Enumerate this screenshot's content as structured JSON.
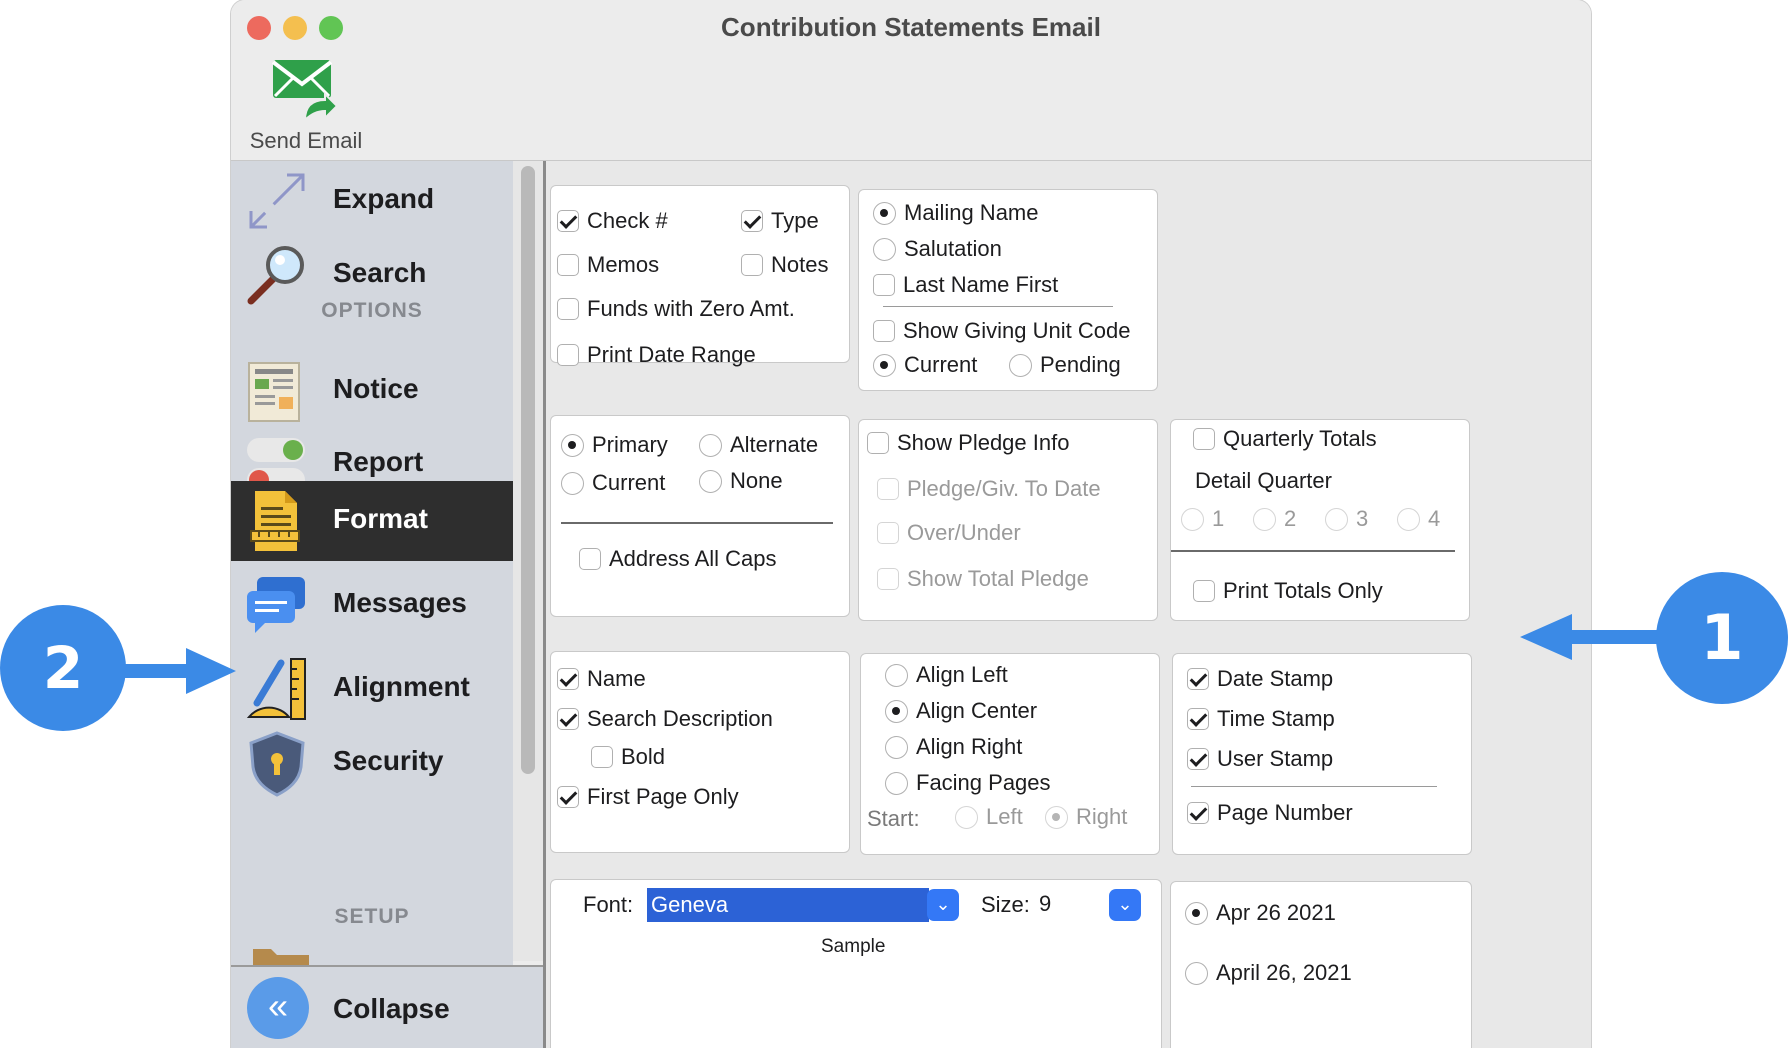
{
  "window": {
    "title": "Contribution Statements Email",
    "toolbar": {
      "send_label": "Send Email"
    }
  },
  "sidebar": {
    "items": [
      {
        "label": "Expand"
      },
      {
        "label": "Search"
      },
      {
        "label": "Notice"
      },
      {
        "label": "Report"
      },
      {
        "label": "Format",
        "active": true
      },
      {
        "label": "Messages"
      },
      {
        "label": "Alignment"
      },
      {
        "label": "Security"
      }
    ],
    "options_header": "OPTIONS",
    "setup_header": "SETUP",
    "collapse_label": "Collapse"
  },
  "panel_columns": {
    "check_num": {
      "label": "Check #",
      "checked": true
    },
    "type": {
      "label": "Type",
      "checked": true
    },
    "memos": {
      "label": "Memos",
      "checked": false
    },
    "notes": {
      "label": "Notes",
      "checked": false
    },
    "funds_zero": {
      "label": "Funds with Zero Amt.",
      "checked": false
    },
    "print_date_range": {
      "label": "Print Date Range",
      "checked": false
    }
  },
  "panel_name": {
    "mailing_name": {
      "label": "Mailing Name",
      "selected": true
    },
    "salutation": {
      "label": "Salutation",
      "selected": false
    },
    "last_name_first": {
      "label": "Last Name First",
      "checked": false
    },
    "show_giving_unit_code": {
      "label": "Show Giving Unit Code",
      "checked": false
    },
    "current": {
      "label": "Current",
      "selected": true
    },
    "pending": {
      "label": "Pending",
      "selected": false
    }
  },
  "panel_address": {
    "primary": {
      "label": "Primary",
      "selected": true
    },
    "alternate": {
      "label": "Alternate",
      "selected": false
    },
    "current": {
      "label": "Current",
      "selected": false
    },
    "none": {
      "label": "None",
      "selected": false
    },
    "address_all_caps": {
      "label": "Address All Caps",
      "checked": false
    }
  },
  "panel_pledge": {
    "show_pledge_info": {
      "label": "Show Pledge Info",
      "checked": false
    },
    "pledge_giv_to_date": {
      "label": "Pledge/Giv. To Date",
      "checked": false
    },
    "over_under": {
      "label": "Over/Under",
      "checked": false
    },
    "show_total_pledge": {
      "label": "Show Total Pledge",
      "checked": false
    }
  },
  "panel_quarterly": {
    "quarterly_totals": {
      "label": "Quarterly Totals",
      "checked": false
    },
    "detail_quarter_label": "Detail Quarter",
    "quarters": [
      "1",
      "2",
      "3",
      "4"
    ],
    "print_totals_only": {
      "label": "Print Totals Only",
      "checked": false
    }
  },
  "panel_header": {
    "name": {
      "label": "Name",
      "checked": true
    },
    "search_description": {
      "label": "Search Description",
      "checked": true
    },
    "bold": {
      "label": "Bold",
      "checked": false
    },
    "first_page_only": {
      "label": "First Page Only",
      "checked": true
    }
  },
  "panel_align": {
    "align_left": {
      "label": "Align Left",
      "selected": false
    },
    "align_center": {
      "label": "Align Center",
      "selected": true
    },
    "align_right": {
      "label": "Align Right",
      "selected": false
    },
    "facing_pages": {
      "label": "Facing Pages",
      "selected": false
    },
    "start_label": "Start:",
    "start_left": {
      "label": "Left",
      "selected": false
    },
    "start_right": {
      "label": "Right",
      "selected": true
    }
  },
  "panel_stamps": {
    "date_stamp": {
      "label": "Date Stamp",
      "checked": true
    },
    "time_stamp": {
      "label": "Time Stamp",
      "checked": true
    },
    "user_stamp": {
      "label": "User Stamp",
      "checked": true
    },
    "page_number": {
      "label": "Page Number",
      "checked": true
    }
  },
  "panel_font": {
    "font_label": "Font:",
    "font_value": "Geneva",
    "size_label": "Size:",
    "size_value": "9",
    "sample_label": "Sample"
  },
  "panel_date_format": {
    "format_1": {
      "label": "Apr 26 2021",
      "selected": true
    },
    "format_2": {
      "label": "April 26, 2021",
      "selected": false
    }
  },
  "callouts": [
    "1",
    "2"
  ],
  "colors": {
    "callout_blue": "#3b8ae6",
    "selection_blue": "#2c62d6",
    "active_row": "#2e2e2e"
  }
}
